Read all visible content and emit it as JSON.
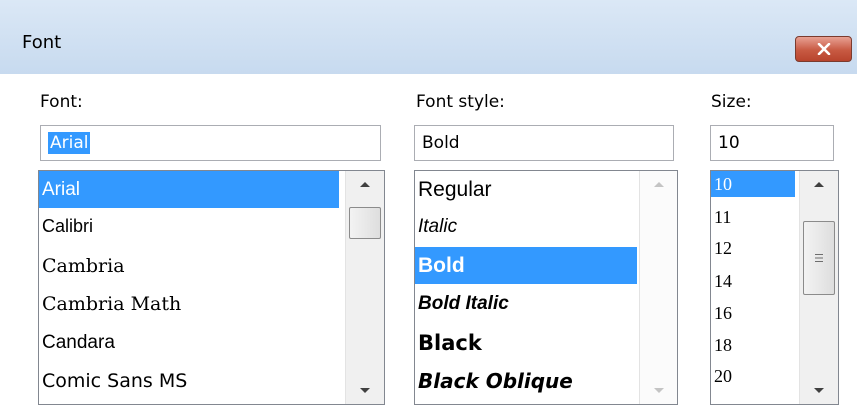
{
  "window": {
    "title": "Font",
    "close_icon": "close-icon",
    "close_button_color": "#c85a43"
  },
  "font": {
    "label": "Font:",
    "input_value": "Arial",
    "items": [
      "Arial",
      "Calibri",
      "Cambria",
      "Cambria Math",
      "Candara",
      "Comic Sans MS"
    ],
    "selected_index": 0
  },
  "font_style": {
    "label": "Font style:",
    "input_value": "Bold",
    "items": [
      "Regular",
      "Italic",
      "Bold",
      "Bold Italic",
      "Black",
      "Black Oblique"
    ],
    "selected_index": 2
  },
  "size": {
    "label": "Size:",
    "input_value": "10",
    "items": [
      "10",
      "11",
      "12",
      "14",
      "16",
      "18",
      "20"
    ],
    "selected_index": 0
  },
  "colors": {
    "selection": "#3399ff",
    "titlebar": "#c7daef"
  }
}
